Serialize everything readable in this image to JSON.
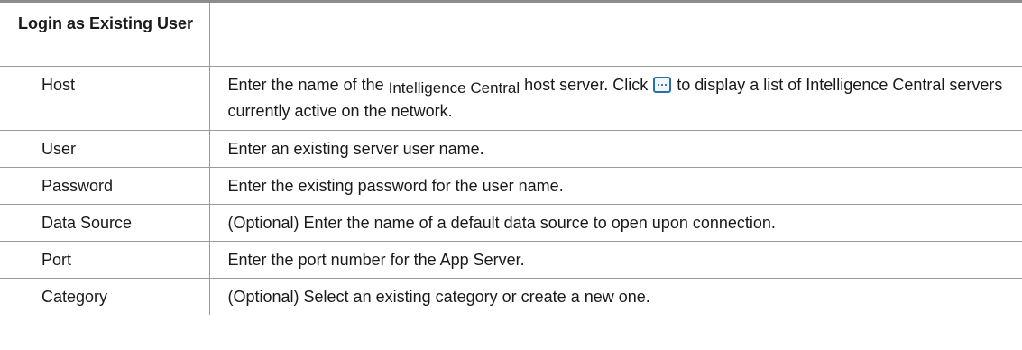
{
  "section": {
    "title": "Login as Existing User"
  },
  "rows": [
    {
      "label": "Host",
      "desc_part1": "Enter the name of the ",
      "desc_product": "Intelligence Central",
      "desc_part2": " host server. Click ",
      "desc_icon": "browse-ellipsis-icon",
      "desc_part3": " to display a list of Intelligence Central servers currently active on the network."
    },
    {
      "label": "User",
      "desc": "Enter an existing server user name."
    },
    {
      "label": "Password",
      "desc": "Enter the existing password for the user name."
    },
    {
      "label": "Data Source",
      "desc": "(Optional) Enter the name of a default data source to open upon connection."
    },
    {
      "label": "Port",
      "desc": "Enter the port number for the App Server."
    },
    {
      "label": "Category",
      "desc": "(Optional) Select an existing category or create a new one."
    }
  ],
  "colors": {
    "border": "#9a9a9a",
    "top_rule": "#8c8c8c",
    "icon_accent": "#2b6fa8"
  }
}
